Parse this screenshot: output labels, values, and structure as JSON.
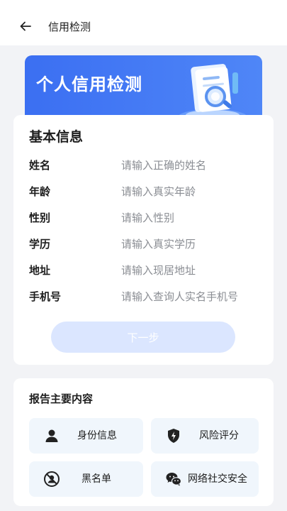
{
  "nav": {
    "title": "信用检测"
  },
  "banner": {
    "title": "个人信用检测"
  },
  "basic_info": {
    "title": "基本信息",
    "fields": [
      {
        "label": "姓名",
        "placeholder": "请输入正确的姓名"
      },
      {
        "label": "年龄",
        "placeholder": "请输入真实年龄"
      },
      {
        "label": "性别",
        "placeholder": "请输入性别"
      },
      {
        "label": "学历",
        "placeholder": "请输入真实学历"
      },
      {
        "label": "地址",
        "placeholder": "请输入现居地址"
      },
      {
        "label": "手机号",
        "placeholder": "请输入查询人实名手机号"
      }
    ],
    "next_button": "下一步"
  },
  "report": {
    "title": "报告主要内容",
    "items": [
      {
        "label": "身份信息",
        "icon": "person-icon"
      },
      {
        "label": "风险评分",
        "icon": "shield-bolt-icon"
      },
      {
        "label": "黑名单",
        "icon": "blacklist-user-icon"
      },
      {
        "label": "网络社交安全",
        "icon": "wechat-icon"
      }
    ]
  },
  "colors": {
    "banner": "#3b6ff2",
    "button_disabled": "#dbe6ff",
    "tile_bg": "#f0f6fc",
    "page_bg": "#f2f3f6"
  }
}
